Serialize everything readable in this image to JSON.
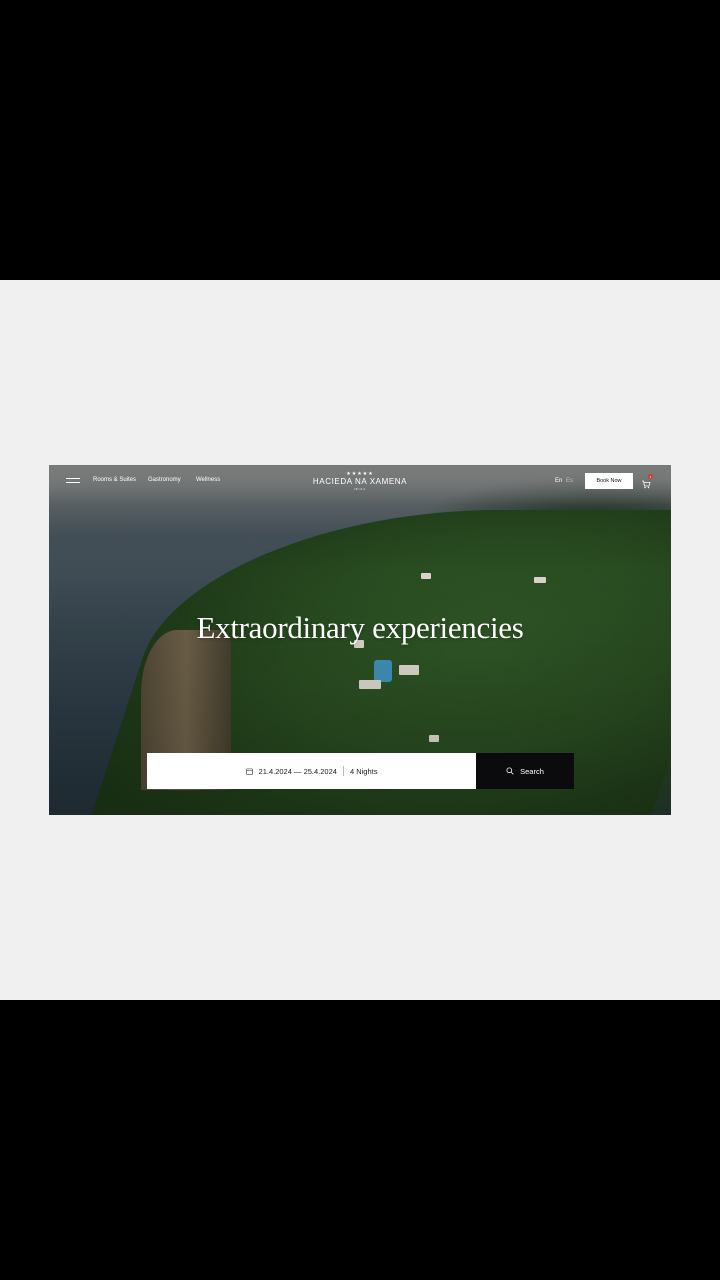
{
  "nav": {
    "menu_icon": "hamburger-icon",
    "links": [
      "Rooms & Suites",
      "Gastronomy",
      "Wellness"
    ],
    "brand": {
      "stars": "★★★★★",
      "name": "HACIEDA NA XAMENA",
      "sub": "IBIZA"
    },
    "languages": [
      "En",
      "Es"
    ],
    "book_label": "Book Now",
    "cart_icon": "cart-icon",
    "cart_count": "1"
  },
  "hero": {
    "headline": "Extraordinary experiencies"
  },
  "booking": {
    "calendar_icon": "calendar-icon",
    "dates": "21.4.2024 — 25.4.2024",
    "nights": "4 Nights",
    "search_icon": "search-icon",
    "search_label": "Search"
  },
  "colors": {
    "dark_button": "#0b0b0d",
    "panel_bg": "#f1f0f1",
    "badge": "#d23a3a"
  }
}
